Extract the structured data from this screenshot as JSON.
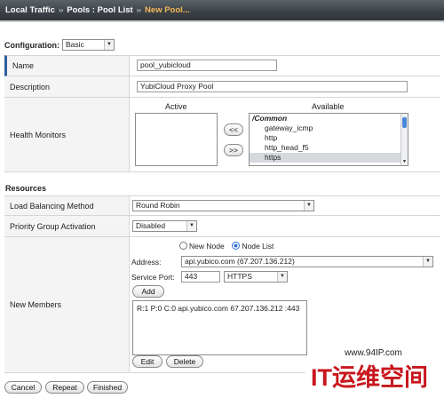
{
  "breadcrumb": {
    "items": [
      "Local Traffic",
      "Pools : Pool List",
      "New Pool..."
    ],
    "separator": "››"
  },
  "configuration": {
    "label": "Configuration:",
    "mode": "Basic"
  },
  "general": {
    "name_label": "Name",
    "name_value": "pool_yubicloud",
    "description_label": "Description",
    "description_value": "YubiCloud Proxy Pool",
    "health_label": "Health Monitors",
    "active_header": "Active",
    "available_header": "Available",
    "move_left": "<<",
    "move_right": ">>",
    "available_items": [
      "/Common",
      "gateway_icmp",
      "http",
      "http_head_f5",
      "https"
    ],
    "selected_available": "https"
  },
  "resources": {
    "section_title": "Resources",
    "lb_label": "Load Balancing Method",
    "lb_value": "Round Robin",
    "pga_label": "Priority Group Activation",
    "pga_value": "Disabled",
    "members_label": "New Members",
    "radio_new_node": "New Node",
    "radio_node_list": "Node List",
    "radio_selected": "Node List",
    "address_label": "Address:",
    "address_value": "api.yubico.com (67.207.136.212)",
    "port_label": "Service Port:",
    "port_value": "443",
    "service_value": "HTTPS",
    "add_label": "Add",
    "member_entry": "R:1 P:0 C:0 api.yubico.com 67.207.136.212 :443",
    "edit_label": "Edit",
    "delete_label": "Delete"
  },
  "footer": {
    "cancel": "Cancel",
    "repeat": "Repeat",
    "finished": "Finished"
  },
  "watermark": {
    "url": "www.94IP.com",
    "brand": "IT运维空间"
  },
  "colors": {
    "breadcrumb_current": "#f5b75a",
    "watermark_red": "#c8161d"
  }
}
